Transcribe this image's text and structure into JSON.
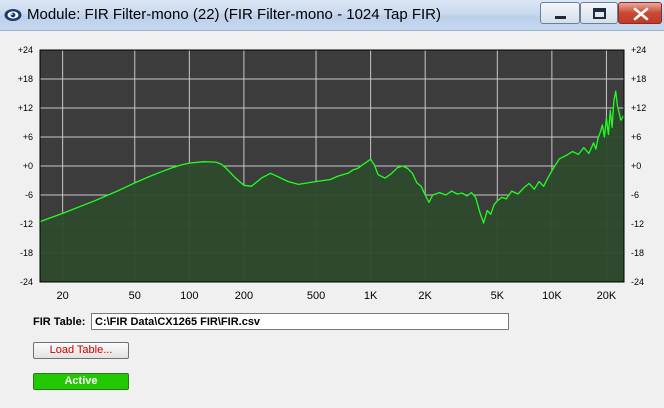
{
  "window": {
    "title": "Module: FIR Filter-mono (22) (FIR Filter-mono - 1024 Tap FIR)",
    "icons": {
      "app": "eye-icon",
      "minimize": "minimize-icon",
      "maximize": "maximize-icon",
      "close": "close-icon"
    }
  },
  "fir_table": {
    "label": "FIR Table:",
    "value": "C:\\FIR Data\\CX1265 FIR\\FIR.csv"
  },
  "buttons": {
    "load_table": "Load Table...",
    "active": "Active"
  },
  "colors": {
    "plot_background": "#3c3c3c",
    "grid": "#c8c8c8",
    "curve": "#20ff20",
    "fill": "#2d4a2d",
    "load_text": "#cc0000",
    "active_bg": "#22c800"
  },
  "chart_data": {
    "type": "area",
    "x_scale": "log",
    "xlim": [
      15,
      25000
    ],
    "ylim": [
      -24,
      24
    ],
    "x_ticks": [
      20,
      50,
      100,
      200,
      500,
      1000,
      2000,
      5000,
      10000,
      20000
    ],
    "x_tick_labels": [
      "20",
      "50",
      "100",
      "200",
      "500",
      "1K",
      "2K",
      "5K",
      "10K",
      "20K"
    ],
    "y_ticks": [
      24,
      18,
      12,
      6,
      0,
      -6,
      -12,
      -18,
      -24
    ],
    "y_tick_labels": [
      "+24",
      "+18",
      "+12",
      "+6",
      "+0",
      "-6",
      "-12",
      "-18",
      "-24"
    ],
    "grid": true,
    "series": [
      {
        "x": [
          15,
          20,
          30,
          40,
          50,
          60,
          70,
          80,
          90,
          100,
          120,
          140,
          150,
          160,
          180,
          200,
          220,
          250,
          280,
          300,
          350,
          400,
          450,
          500,
          550,
          600,
          650,
          700,
          750,
          800,
          850,
          900,
          950,
          1000,
          1050,
          1100,
          1200,
          1300,
          1400,
          1500,
          1600,
          1700,
          1800,
          1900,
          2000,
          2100,
          2200,
          2400,
          2600,
          2800,
          3000,
          3200,
          3400,
          3600,
          3800,
          4000,
          4200,
          4400,
          4600,
          4800,
          5000,
          5300,
          5600,
          6000,
          6500,
          7000,
          7500,
          8000,
          8500,
          9000,
          9500,
          10000,
          10500,
          11000,
          12000,
          13000,
          14000,
          15000,
          16000,
          17000,
          17500,
          18000,
          18500,
          19000,
          19500,
          20000,
          20500,
          21000,
          21500,
          22000,
          22500,
          23000,
          24000,
          25000
        ],
        "y": [
          -11.5,
          -9.8,
          -7.2,
          -5.2,
          -3.5,
          -2.2,
          -1.2,
          -0.4,
          0.2,
          0.6,
          0.9,
          0.8,
          0.4,
          -0.5,
          -2.5,
          -4.0,
          -4.2,
          -2.5,
          -1.5,
          -2.0,
          -3.2,
          -3.8,
          -3.5,
          -3.2,
          -3.0,
          -2.8,
          -2.2,
          -1.8,
          -1.5,
          -0.8,
          -0.5,
          0.2,
          0.8,
          1.4,
          0.2,
          -1.8,
          -2.5,
          -1.6,
          -0.4,
          0.0,
          -0.5,
          -1.5,
          -3.5,
          -4.2,
          -6.0,
          -7.5,
          -6.0,
          -5.5,
          -6.0,
          -5.2,
          -5.8,
          -5.6,
          -6.2,
          -5.5,
          -6.5,
          -9.5,
          -11.8,
          -9.2,
          -10.0,
          -8.0,
          -7.2,
          -6.5,
          -6.8,
          -5.2,
          -5.8,
          -4.5,
          -3.6,
          -4.8,
          -3.2,
          -4.2,
          -2.5,
          -1.0,
          0.3,
          1.5,
          2.2,
          3.0,
          2.4,
          3.8,
          2.6,
          4.8,
          3.5,
          5.8,
          7.0,
          8.5,
          6.0,
          10.0,
          6.5,
          11.5,
          8.0,
          13.5,
          15.5,
          12.5,
          9.5,
          10.5
        ]
      }
    ]
  }
}
